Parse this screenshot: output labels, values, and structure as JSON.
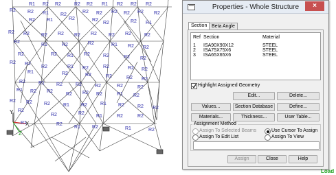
{
  "dialog": {
    "title": "Properties - Whole Structure",
    "tabs": [
      "Section",
      "Beta Angle"
    ],
    "columns": {
      "ref": "Ref",
      "section": "Section",
      "material": "Material"
    },
    "rows": [
      {
        "ref": "1",
        "section": "ISA90X90X12",
        "material": "STEEL"
      },
      {
        "ref": "2",
        "section": "ISA75X75X6",
        "material": "STEEL"
      },
      {
        "ref": "3",
        "section": "ISA65X65X6",
        "material": "STEEL"
      }
    ],
    "highlight_label": "Highlight Assigned Geometry",
    "highlight_checked": true,
    "buttons": {
      "edit": "Edit...",
      "delete": "Delete...",
      "values": "Values...",
      "section_database": "Section Database",
      "define": "Define...",
      "materials": "Materials...",
      "thickness": "Thickness...",
      "user_table": "User Table..."
    },
    "assignment_method": {
      "heading": "Assignment Method",
      "selected_beams": "Assign To Selected Beams",
      "use_cursor": "Use Cursor To Assign",
      "edit_list": "Assign To Edit List",
      "assign_to_view": "Assign To View",
      "selected_option": "Use Cursor To Assign"
    },
    "footer": {
      "assign": "Assign",
      "close": "Close",
      "help": "Help"
    },
    "close_glyph": "×"
  },
  "status": {
    "load": "Load"
  },
  "model": {
    "labels": [
      "R1",
      "R2",
      "R2",
      "R2",
      "R2",
      "R1",
      "R2",
      "R2",
      "R2",
      "R2",
      "R2",
      "R1",
      "R2",
      "R2",
      "R2",
      "R2",
      "R2",
      "R2",
      "R2",
      "R2",
      "R1",
      "R2",
      "R2",
      "R2",
      "R2",
      "R1",
      "R2",
      "R2",
      "R2",
      "R2",
      "R2",
      "R2",
      "R2",
      "R2",
      "R2",
      "R2",
      "R1",
      "R2",
      "R2",
      "R1",
      "R2",
      "R2",
      "R2",
      "R2",
      "R1",
      "R2",
      "R2",
      "R2",
      "R2",
      "R2",
      "R2",
      "R2",
      "R1",
      "R2",
      "R2",
      "R2",
      "R2",
      "R1",
      "R2",
      "R2",
      "R2",
      "R2",
      "R2",
      "R2",
      "R1",
      "R2",
      "R2",
      "R2",
      "R2",
      "R2",
      "R1",
      "R2",
      "R2",
      "R2",
      "R2",
      "R2",
      "R1",
      "R2",
      "R2",
      "R2",
      "R2",
      "R1",
      "R2",
      "R1",
      "R2",
      "R2",
      "R2",
      "R2",
      "R2",
      "R2",
      "R1",
      "R2",
      "R2",
      "R1",
      "R2",
      "R1",
      "R2",
      "R1",
      "R2",
      "R2",
      "R2",
      "R1"
    ],
    "axis": {
      "y": "Y",
      "x": "X",
      "z": "Z"
    }
  },
  "colors": {
    "member": "#3b3b3b",
    "label": "#2a2aa8",
    "accent": "#d22020",
    "support": "#333333"
  }
}
